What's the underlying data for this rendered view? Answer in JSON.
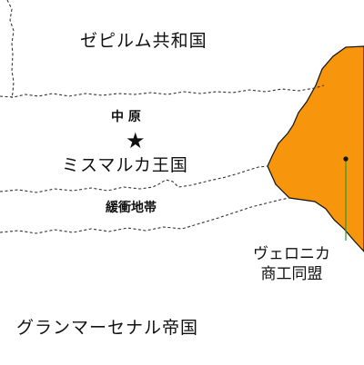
{
  "map": {
    "regions": [
      {
        "name": "ゼピルム共和国"
      },
      {
        "name": "ミスマルカ王国",
        "marker": "star-icon"
      },
      {
        "name": "緩衝地帯"
      },
      {
        "name": "グランマーセナル帝国"
      },
      {
        "name": "ヴェロニカ商工同盟",
        "lines": [
          "ヴェロニカ",
          "商工同盟"
        ],
        "fill": "#f7960c"
      }
    ],
    "subregion": {
      "name": "中 原"
    },
    "marker_symbol": "★"
  }
}
